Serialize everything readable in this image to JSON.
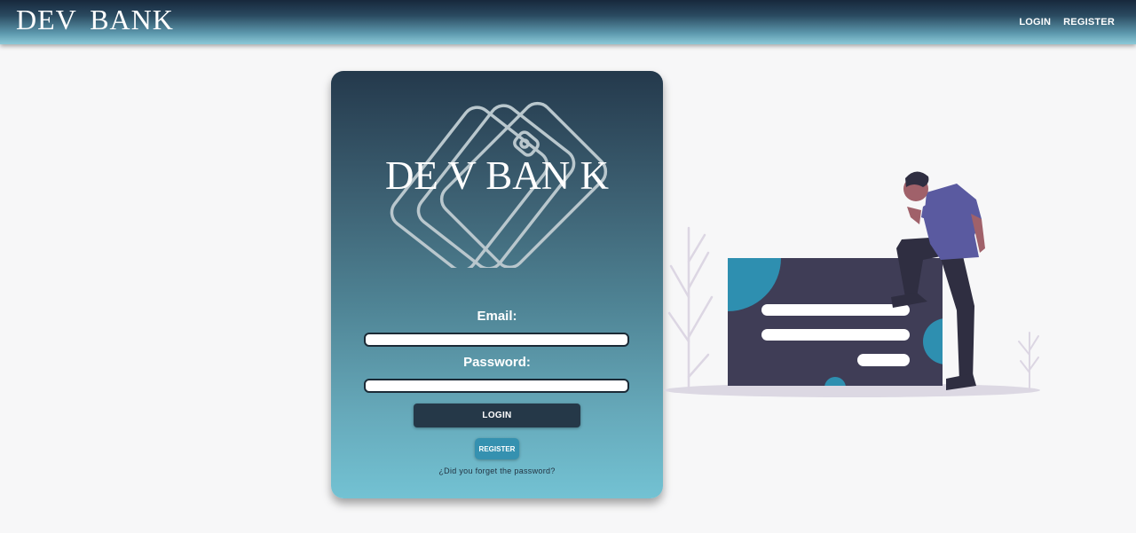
{
  "header": {
    "brand": "DEV  BANK",
    "nav": {
      "login": "LOGIN",
      "register": "REGISTER"
    }
  },
  "card": {
    "logo_text": "DE V BAN K",
    "email_label": "Email:",
    "email_value": "",
    "password_label": "Password:",
    "password_value": "",
    "login_button": "LOGIN",
    "register_button": "REGISTER",
    "forgot_link": "¿Did you forget the password?"
  },
  "icons": {
    "logo": "wallet-icon",
    "illustration": "person-with-card-illustration"
  },
  "colors": {
    "header_dark": "#17283c",
    "header_light": "#8cc9d8",
    "card_top": "#24394c",
    "card_bottom": "#73c2d3",
    "login_button": "#253848",
    "register_button": "#3591b0",
    "accent_teal": "#2e8fb0",
    "illustration_panel": "#3f3d56",
    "illustration_shirt": "#5a5aa0"
  }
}
